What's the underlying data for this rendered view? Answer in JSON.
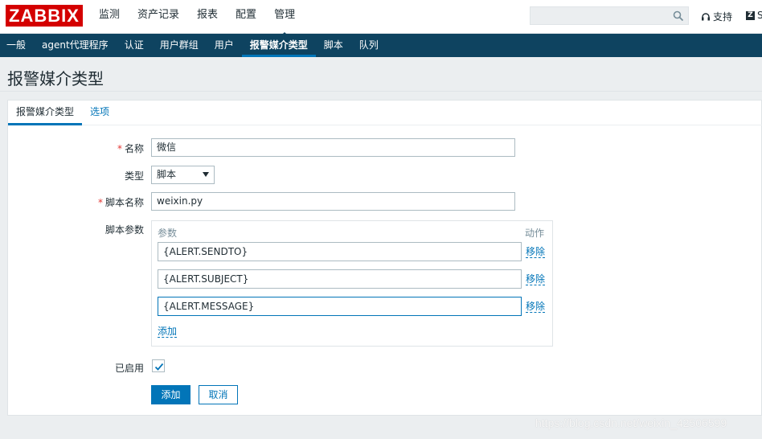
{
  "header": {
    "logo": "ZABBIX",
    "nav": [
      "监测",
      "资产记录",
      "报表",
      "配置",
      "管理"
    ],
    "active_nav": "管理",
    "search_placeholder": "",
    "support_label": "支持",
    "share_label": "S"
  },
  "subnav": {
    "items": [
      "一般",
      "agent代理程序",
      "认证",
      "用户群组",
      "用户",
      "报警媒介类型",
      "脚本",
      "队列"
    ],
    "active": "报警媒介类型"
  },
  "page": {
    "title": "报警媒介类型"
  },
  "tabs": [
    "报警媒介类型",
    "选项"
  ],
  "form": {
    "name_label": "名称",
    "name_value": "微信",
    "type_label": "类型",
    "type_value": "脚本",
    "script_name_label": "脚本名称",
    "script_name_value": "weixin.py",
    "script_params_label": "脚本参数",
    "params_header": "参数",
    "action_header": "动作",
    "params": [
      "{ALERT.SENDTO}",
      "{ALERT.SUBJECT}",
      "{ALERT.MESSAGE}"
    ],
    "remove_label": "移除",
    "add_link": "添加",
    "enabled_label": "已启用",
    "enabled": true,
    "add_button": "添加",
    "cancel_button": "取消"
  },
  "watermark": "https://blog.csdn.net/weixin_42506599",
  "colors": {
    "brand": "#d40000",
    "nav_bg": "#0e4360",
    "accent": "#0275b8",
    "required": "#e33734"
  }
}
